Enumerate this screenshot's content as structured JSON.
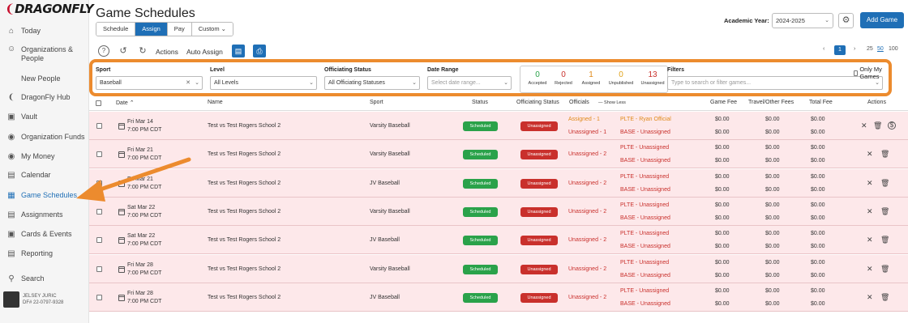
{
  "brand": {
    "logo_text": "DRAGONFLY"
  },
  "sidebar": {
    "items": [
      {
        "label": "Today"
      },
      {
        "label": "Organizations &",
        "label2": "People"
      },
      {
        "label": "New People"
      },
      {
        "label": "DragonFly Hub"
      },
      {
        "label": "Vault"
      },
      {
        "label": "Organization Funds"
      },
      {
        "label": "My Money"
      },
      {
        "label": "Calendar"
      },
      {
        "label": "Game Schedules"
      },
      {
        "label": "Assignments"
      },
      {
        "label": "Cards & Events"
      },
      {
        "label": "Reporting"
      },
      {
        "label": "Search"
      }
    ],
    "user": {
      "name": "JELSEY JURIC",
      "id": "DF# 22-0797-9328"
    }
  },
  "header": {
    "title": "Game Schedules",
    "tabs": [
      "Schedule",
      "Assign",
      "Pay",
      "Custom"
    ],
    "active_tab": "Assign",
    "academic_year_label": "Academic Year:",
    "academic_year_value": "2024-2025",
    "add_game_label": "Add Game"
  },
  "toolbar": {
    "actions_label": "Actions",
    "auto_assign_label": "Auto Assign",
    "pagination": {
      "current_page": "1",
      "page_sizes": [
        "25",
        "50",
        "100"
      ],
      "selected_size": "50"
    }
  },
  "filters": {
    "sport": {
      "label": "Sport",
      "value": "Baseball"
    },
    "level": {
      "label": "Level",
      "value": "All Levels"
    },
    "officiating_status": {
      "label": "Officiating Status",
      "value": "All Officiating Statuses"
    },
    "date_range": {
      "label": "Date Range",
      "placeholder": "Select date range..."
    },
    "counts": [
      {
        "value": "0",
        "label": "Accepted",
        "color": "#2aa24a"
      },
      {
        "value": "0",
        "label": "Rejected",
        "color": "#c9302c"
      },
      {
        "value": "1",
        "label": "Assigned",
        "color": "#e08a1a"
      },
      {
        "value": "0",
        "label": "Unpublished",
        "color": "#e0a21a"
      },
      {
        "value": "13",
        "label": "Unassigned",
        "color": "#c9302c"
      }
    ],
    "search": {
      "label": "Filters",
      "placeholder": "Type to search or filter games..."
    },
    "only_my_games": "Only My Games"
  },
  "table": {
    "headers": {
      "date": "Date",
      "name": "Name",
      "sport": "Sport",
      "status": "Status",
      "officiating_status": "Officiating Status",
      "officials": "Officials",
      "show_less": "Show Less",
      "game_fee": "Game Fee",
      "travel_fees": "Travel/Other Fees",
      "total_fee": "Total Fee",
      "actions": "Actions"
    },
    "rows": [
      {
        "date": "Fri Mar 14",
        "time": "7:00 PM CDT",
        "name": "Test vs Test Rogers School 2",
        "sport": "Varsity Baseball",
        "status": "Scheduled",
        "officiating": "Unassigned",
        "summary": [
          "Assigned - 1",
          "Unassigned - 1"
        ],
        "officials": [
          "PLTE - Ryan Official",
          "BASE - Unassigned"
        ],
        "game_fee": [
          "$0.00",
          "$0.00"
        ],
        "travel": [
          "$0.00",
          "$0.00"
        ],
        "total": [
          "$0.00",
          "$0.00"
        ]
      },
      {
        "date": "Fri Mar 21",
        "time": "7:00 PM CDT",
        "name": "Test vs Test Rogers School 2",
        "sport": "Varsity Baseball",
        "status": "Scheduled",
        "officiating": "Unassigned",
        "summary": [
          "Unassigned - 2"
        ],
        "officials": [
          "PLTE - Unassigned",
          "BASE - Unassigned"
        ],
        "game_fee": [
          "$0.00",
          "$0.00"
        ],
        "travel": [
          "$0.00",
          "$0.00"
        ],
        "total": [
          "$0.00",
          "$0.00"
        ]
      },
      {
        "date": "Fri Mar 21",
        "time": "7:00 PM CDT",
        "name": "Test vs Test Rogers School 2",
        "sport": "JV Baseball",
        "status": "Scheduled",
        "officiating": "Unassigned",
        "summary": [
          "Unassigned - 2"
        ],
        "officials": [
          "PLTE - Unassigned",
          "BASE - Unassigned"
        ],
        "game_fee": [
          "$0.00",
          "$0.00"
        ],
        "travel": [
          "$0.00",
          "$0.00"
        ],
        "total": [
          "$0.00",
          "$0.00"
        ]
      },
      {
        "date": "Sat Mar 22",
        "time": "7:00 PM CDT",
        "name": "Test vs Test Rogers School 2",
        "sport": "Varsity Baseball",
        "status": "Scheduled",
        "officiating": "Unassigned",
        "summary": [
          "Unassigned - 2"
        ],
        "officials": [
          "PLTE - Unassigned",
          "BASE - Unassigned"
        ],
        "game_fee": [
          "$0.00",
          "$0.00"
        ],
        "travel": [
          "$0.00",
          "$0.00"
        ],
        "total": [
          "$0.00",
          "$0.00"
        ]
      },
      {
        "date": "Sat Mar 22",
        "time": "7:00 PM CDT",
        "name": "Test vs Test Rogers School 2",
        "sport": "JV Baseball",
        "status": "Scheduled",
        "officiating": "Unassigned",
        "summary": [
          "Unassigned - 2"
        ],
        "officials": [
          "PLTE - Unassigned",
          "BASE - Unassigned"
        ],
        "game_fee": [
          "$0.00",
          "$0.00"
        ],
        "travel": [
          "$0.00",
          "$0.00"
        ],
        "total": [
          "$0.00",
          "$0.00"
        ]
      },
      {
        "date": "Fri Mar 28",
        "time": "7:00 PM CDT",
        "name": "Test vs Test Rogers School 2",
        "sport": "Varsity Baseball",
        "status": "Scheduled",
        "officiating": "Unassigned",
        "summary": [
          "Unassigned - 2"
        ],
        "officials": [
          "PLTE - Unassigned",
          "BASE - Unassigned"
        ],
        "game_fee": [
          "$0.00",
          "$0.00"
        ],
        "travel": [
          "$0.00",
          "$0.00"
        ],
        "total": [
          "$0.00",
          "$0.00"
        ]
      },
      {
        "date": "Fri Mar 28",
        "time": "7:00 PM CDT",
        "name": "Test vs Test Rogers School 2",
        "sport": "JV Baseball",
        "status": "Scheduled",
        "officiating": "Unassigned",
        "summary": [
          "Unassigned - 2"
        ],
        "officials": [
          "PLTE - Unassigned",
          "BASE - Unassigned"
        ],
        "game_fee": [
          "$0.00",
          "$0.00"
        ],
        "travel": [
          "$0.00",
          "$0.00"
        ],
        "total": [
          "$0.00",
          "$0.00"
        ]
      }
    ]
  }
}
